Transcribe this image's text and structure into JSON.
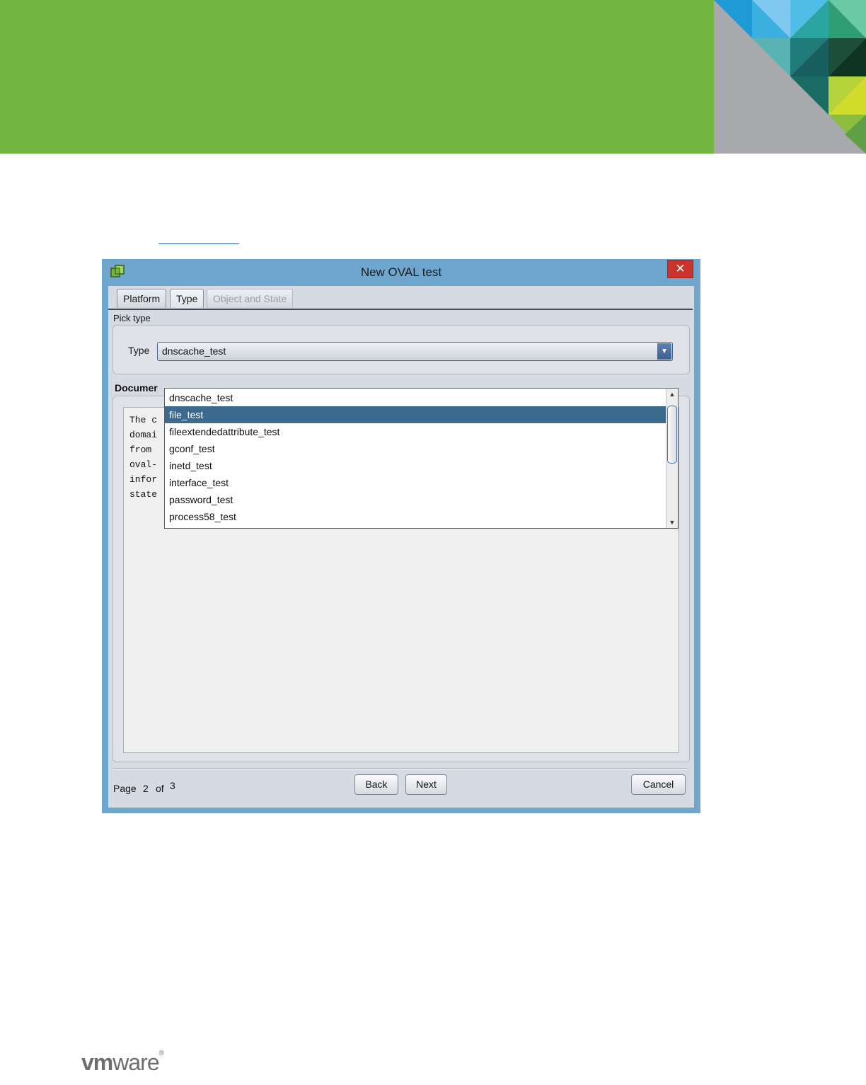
{
  "colors": {
    "banner_green": "#72b541",
    "window_frame": "#6fa6cd",
    "selection": "#3b6a8f",
    "close_red": "#c9332c"
  },
  "dialog": {
    "title": "New OVAL test",
    "close_glyph": "✕",
    "tabs": [
      {
        "label": "Platform",
        "state": "normal"
      },
      {
        "label": "Type",
        "state": "active"
      },
      {
        "label": "Object and State",
        "state": "disabled"
      }
    ],
    "pick_type_label": "Pick type",
    "type_label": "Type",
    "type_value": "dnscache_test",
    "documentation_label": "Documer",
    "documentation_lines": [
      "The c",
      "domai",
      "from",
      "oval-",
      "infor",
      "state"
    ],
    "dropdown_items": [
      "dnscache_test",
      "file_test",
      "fileextendedattribute_test",
      "gconf_test",
      "inetd_test",
      "interface_test",
      "password_test",
      "process58_test"
    ],
    "selected_item": "file_test",
    "pager": {
      "page_word": "Page",
      "current": "2",
      "of_word": "of",
      "total": "3"
    },
    "buttons": {
      "back": "Back",
      "next": "Next",
      "cancel": "Cancel"
    }
  },
  "footer": {
    "logo_bold": "vm",
    "logo_light": "ware",
    "logo_mark": "®"
  }
}
